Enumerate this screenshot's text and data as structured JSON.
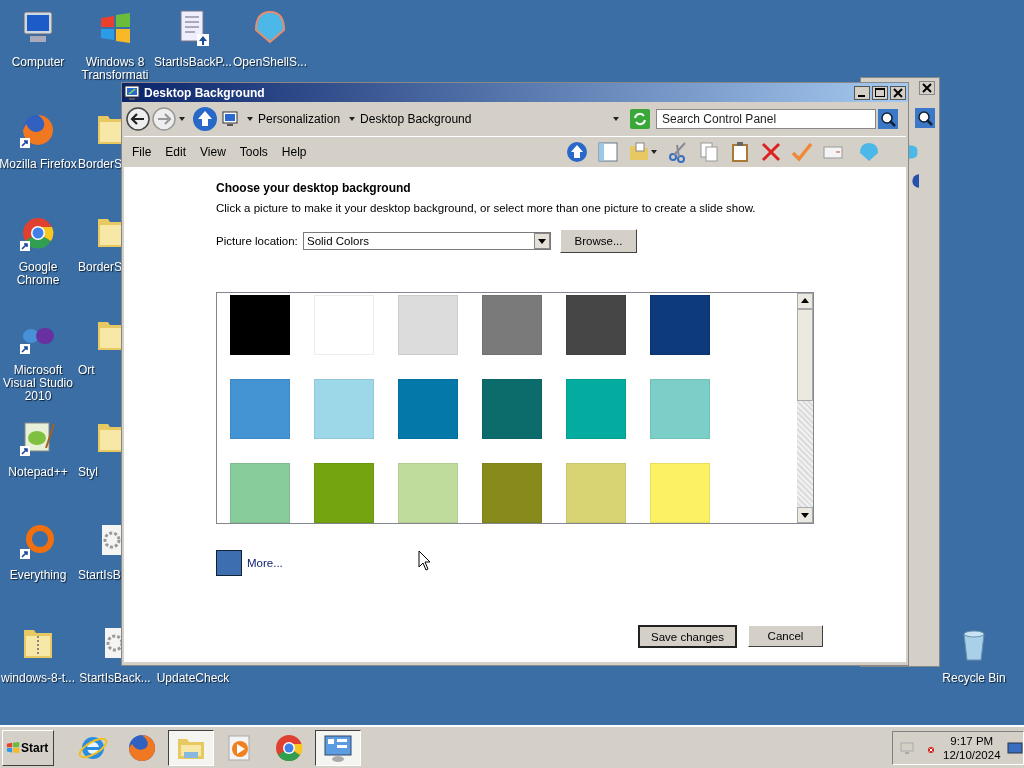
{
  "desktop": {
    "icons": [
      {
        "label": "Computer",
        "kind": "computer",
        "shortcut": false
      },
      {
        "label": "Windows 8 Transformati",
        "kind": "windows",
        "shortcut": false
      },
      {
        "label": "StartIsBackP...",
        "kind": "document",
        "shortcut": false
      },
      {
        "label": "OpenShellS...",
        "kind": "shell",
        "shortcut": false
      },
      {
        "label": "Mozilla Firefox",
        "kind": "firefox",
        "shortcut": true
      },
      {
        "label": "BorderS",
        "kind": "folder",
        "shortcut": false
      },
      {
        "label": "Google Chrome",
        "kind": "chrome",
        "shortcut": true
      },
      {
        "label": "BorderS",
        "kind": "folder",
        "shortcut": false
      },
      {
        "label": "Microsoft Visual Studio 2010",
        "kind": "vs",
        "shortcut": true
      },
      {
        "label": "Ort",
        "kind": "folder",
        "shortcut": false
      },
      {
        "label": "Notepad++",
        "kind": "notepad",
        "shortcut": true
      },
      {
        "label": "Styl",
        "kind": "folder",
        "shortcut": false
      },
      {
        "label": "Everything",
        "kind": "ring",
        "shortcut": true
      },
      {
        "label": "StartIsB",
        "kind": "setup",
        "shortcut": false
      },
      {
        "label": "windows-8-t...",
        "kind": "zip",
        "shortcut": false
      },
      {
        "label": "StartIsBack...",
        "kind": "setup",
        "shortcut": false
      },
      {
        "label": "UpdateCheck",
        "kind": "none"
      },
      {
        "label": "Recycle Bin",
        "kind": "recycle",
        "shortcut": false
      }
    ]
  },
  "window": {
    "title": "Desktop Background",
    "breadcrumb": [
      "Personalization",
      "Desktop Background"
    ],
    "search": {
      "placeholder": "Search Control Panel"
    },
    "menu": [
      "File",
      "Edit",
      "View",
      "Tools",
      "Help"
    ],
    "heading": "Choose your desktop background",
    "description": "Click a picture to make it your desktop background, or select more than one picture to create a slide show.",
    "picture_location": {
      "label": "Picture location:",
      "value": "Solid Colors",
      "browse": "Browse..."
    },
    "swatches": [
      {
        "color": "#000000"
      },
      {
        "color": "#ffffff"
      },
      {
        "color": "#dcdcdc"
      },
      {
        "color": "#7a7a7a"
      },
      {
        "color": "#464646"
      },
      {
        "color": "#0c3a7a"
      },
      {
        "color": "#4494d4"
      },
      {
        "color": "#9cd8e8"
      },
      {
        "color": "#0478a8"
      },
      {
        "color": "#0c6c6c"
      },
      {
        "color": "#04aca0"
      },
      {
        "color": "#7ccfc8"
      },
      {
        "color": "#88cc9c"
      },
      {
        "color": "#74a410"
      },
      {
        "color": "#c0dc9c"
      },
      {
        "color": "#888a1c"
      },
      {
        "color": "#d8d474"
      },
      {
        "color": "#fcf064"
      }
    ],
    "more": {
      "color": "#3c6eb0",
      "label": "More..."
    },
    "buttons": [
      "Save changes",
      "Cancel"
    ]
  },
  "taskbar": {
    "start": "Start",
    "items": [
      {
        "kind": "ie",
        "selected": false
      },
      {
        "kind": "firefox",
        "selected": false
      },
      {
        "kind": "explorer",
        "selected": true
      },
      {
        "kind": "media",
        "selected": false
      },
      {
        "kind": "chrome",
        "selected": false
      },
      {
        "kind": "control",
        "selected": true
      }
    ],
    "time": "9:17 PM",
    "date": "12/10/2024"
  }
}
